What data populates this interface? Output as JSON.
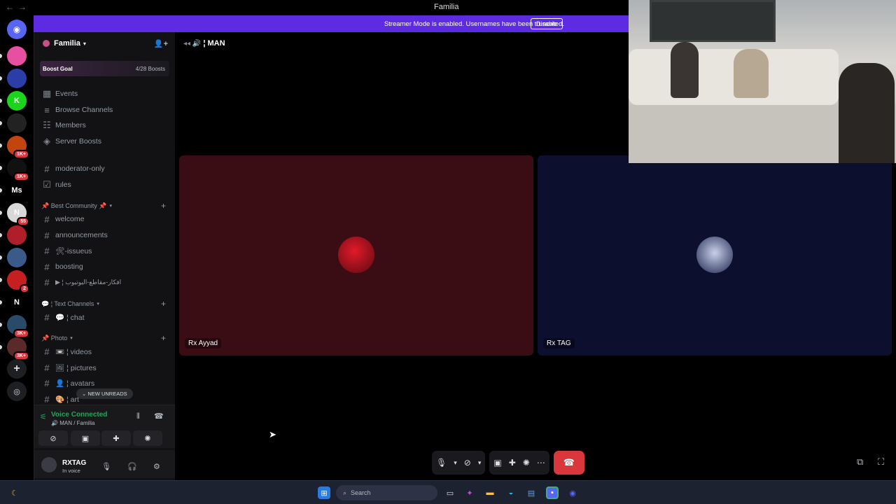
{
  "window": {
    "title": "Familia",
    "nav_back": "←",
    "nav_fwd": "→"
  },
  "banner": {
    "text": "Streamer Mode is enabled. Usernames have been truncated.",
    "disable_label": "Disable",
    "color": "#5d2ce2"
  },
  "servers": [
    {
      "name": "server-1",
      "color": "#e74fa0",
      "label": ""
    },
    {
      "name": "server-2",
      "color": "#2b3ea8",
      "label": ""
    },
    {
      "name": "server-kick",
      "color": "#1bd41b",
      "label": "K"
    },
    {
      "name": "server-4",
      "color": "#222",
      "label": ""
    },
    {
      "name": "server-5",
      "color": "#c2440e",
      "label": "",
      "badge": "1K+"
    },
    {
      "name": "server-6",
      "color": "#111",
      "label": "",
      "badge": "1K+"
    },
    {
      "name": "server-ms",
      "color": "#000",
      "label": "Ms"
    },
    {
      "name": "server-n",
      "color": "#d8d8d8",
      "label": "N",
      "badge": "55"
    },
    {
      "name": "server-9",
      "color": "#b01e2a",
      "label": ""
    },
    {
      "name": "server-10",
      "color": "#3a5a8a",
      "label": ""
    },
    {
      "name": "server-11",
      "color": "#c42020",
      "label": "",
      "badge": "2"
    },
    {
      "name": "server-12",
      "color": "#000",
      "label": "N"
    },
    {
      "name": "server-13",
      "color": "#2a4a6a",
      "label": "",
      "badge": "3K+"
    },
    {
      "name": "server-14",
      "color": "#5a2a2a",
      "label": "",
      "badge": "3K+"
    }
  ],
  "sidebar": {
    "server_name": "Familia",
    "boost_goal": "Boost Goal",
    "boost_count": "4/28 Boosts",
    "menu": [
      {
        "icon": "calendar-icon",
        "label": "Events"
      },
      {
        "icon": "list-icon",
        "label": "Browse Channels"
      },
      {
        "icon": "members-icon",
        "label": "Members"
      },
      {
        "icon": "boost-icon",
        "label": "Server Boosts"
      }
    ],
    "top_channels": [
      "moderator-only",
      "rules"
    ],
    "categories": [
      {
        "label": "📌 Best Community 📌",
        "channels": [
          "welcome",
          "announcements",
          "🛠-issueus",
          "boosting",
          "▶ ¦ افكار-مقاطع-اليوتيوب"
        ]
      },
      {
        "label": "💬 ¦ Text Channels",
        "channels": [
          "💬 ¦ chat"
        ]
      },
      {
        "label": "📌 Photo",
        "channels": [
          "📼 ¦ videos",
          "🖼 ¦ pictures",
          "👤 ¦ avatars",
          "🎨 ¦ art"
        ]
      }
    ],
    "new_unreads": "NEW UNREADS",
    "voice": {
      "status": "Voice Connected",
      "location": "MAN / Familia"
    },
    "user": {
      "name": "RXTAG",
      "status": "In voice"
    }
  },
  "stage": {
    "channel": "¦ MAN",
    "tiles": [
      {
        "name": "Rx Ayyad",
        "bg": "#3a0d14",
        "avatar": "#b3121e"
      },
      {
        "name": "Rx TAG",
        "bg": "#0d0f2e",
        "avatar": "#2a3a6a"
      }
    ]
  },
  "taskbar": {
    "search_placeholder": "Search"
  }
}
